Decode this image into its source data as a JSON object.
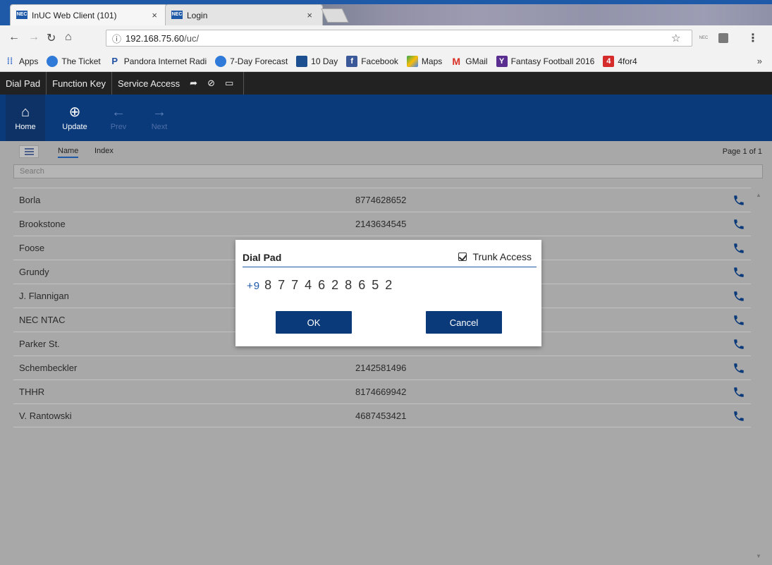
{
  "browser": {
    "tabs": [
      {
        "label": "InUC Web Client (101)",
        "favicon": "NEC",
        "close": "×"
      },
      {
        "label": "Login",
        "favicon": "NEC",
        "close": "×"
      }
    ],
    "address": {
      "host": "192.168.75.60",
      "path": "/uc/"
    },
    "bookmarks": [
      {
        "label": "Apps",
        "icon": "apps-grid-icon"
      },
      {
        "label": "The Ticket",
        "icon": "ticket-icon"
      },
      {
        "label": "Pandora Internet Radi",
        "icon": "pandora-icon"
      },
      {
        "label": "7-Day Forecast",
        "icon": "weather-icon"
      },
      {
        "label": "10 Day",
        "icon": "weather-channel-icon"
      },
      {
        "label": "Facebook",
        "icon": "facebook-icon"
      },
      {
        "label": "Maps",
        "icon": "maps-icon"
      },
      {
        "label": "GMail",
        "icon": "gmail-icon"
      },
      {
        "label": "Fantasy Football 2016",
        "icon": "yahoo-icon"
      },
      {
        "label": "4for4",
        "icon": "4for4-icon"
      }
    ],
    "more_label": "»"
  },
  "app_nav": {
    "items": [
      "Dial Pad",
      "Function Key",
      "Service Access"
    ]
  },
  "toolbar": {
    "home": "Home",
    "update": "Update",
    "prev": "Prev",
    "next": "Next"
  },
  "subnav": {
    "tab_name": "Name",
    "tab_index": "Index",
    "page_info": "Page 1 of 1",
    "search_placeholder": "Search"
  },
  "contacts": [
    {
      "name": "Borla",
      "number": "8774628652"
    },
    {
      "name": "Brookstone",
      "number": "2143634545"
    },
    {
      "name": "Foose",
      "number": ""
    },
    {
      "name": "Grundy",
      "number": ""
    },
    {
      "name": "J. Flannigan",
      "number": ""
    },
    {
      "name": "NEC NTAC",
      "number": ""
    },
    {
      "name": "Parker St.",
      "number": ""
    },
    {
      "name": "Schembeckler",
      "number": "2142581496"
    },
    {
      "name": "THHR",
      "number": "8174669942"
    },
    {
      "name": "V. Rantowski",
      "number": "4687453421"
    }
  ],
  "dialog": {
    "title": "Dial Pad",
    "trunk_label": "Trunk Access",
    "trunk_checked": true,
    "prefix": "+9",
    "number": "8774628652",
    "ok": "OK",
    "cancel": "Cancel"
  },
  "colors": {
    "brand_blue": "#0a3a7a",
    "accent_blue": "#1e5aa8",
    "overlay_grey": "#a8a8a8"
  }
}
